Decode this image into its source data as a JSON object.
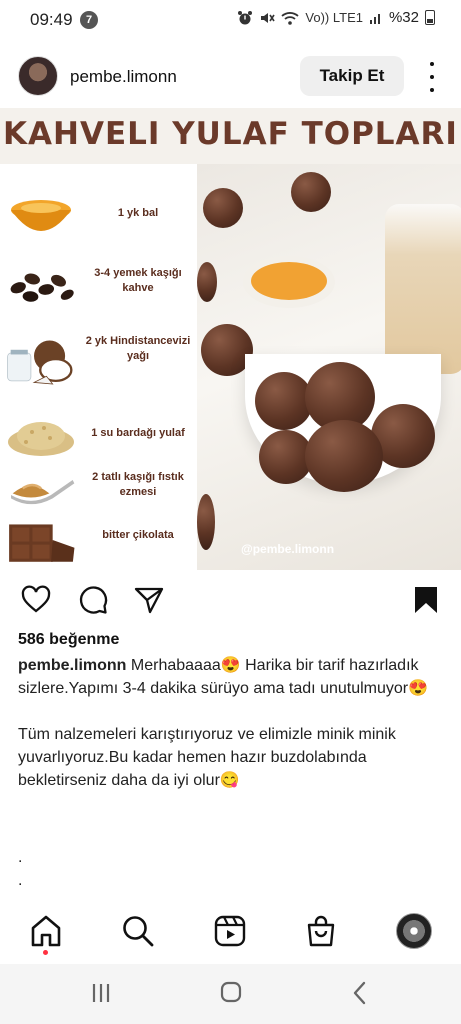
{
  "status_bar": {
    "time": "09:49",
    "notification_count": "7",
    "network": "Vo)) LTE1",
    "battery": "%32"
  },
  "post_header": {
    "username": "pembe.limonn",
    "follow_label": "Takip Et"
  },
  "post_image": {
    "title": "KAHVELI YULAF TOPLARI",
    "ingredients": [
      {
        "label": "1 yk bal",
        "icon": "honey-bowl-icon"
      },
      {
        "label": "3-4 yemek kaşığı kahve",
        "icon": "coffee-beans-icon"
      },
      {
        "label": "2 yk Hindistancevizi yağı",
        "icon": "coconut-icon"
      },
      {
        "label": "1 su bardağı yulaf",
        "icon": "oats-icon"
      },
      {
        "label": "2 tatlı kaşığı fıstık ezmesi",
        "icon": "peanut-butter-spoon-icon"
      },
      {
        "label": "bitter çikolata",
        "icon": "chocolate-bar-icon"
      }
    ],
    "watermark": "@pembe.limonn"
  },
  "actions": {
    "like_icon": "heart-icon",
    "comment_icon": "comment-icon",
    "share_icon": "send-icon",
    "save_icon": "bookmark-icon"
  },
  "likes": "586 beğenme",
  "caption": {
    "username": "pembe.limonn",
    "text1": "Merhabaaaa😍 Harika bir tarif hazırladık sizlere.Yapımı 3-4 dakika sürüyo ama tadı unutulmuyor😍",
    "text2": "Tüm nalzemeleri karıştırıyoruz ve elimizle minik minik yuvarlıyoruz.Bu kadar hemen hazır buzdolabında bekletirseniz daha da iyi olur😋",
    "dot1": ".",
    "dot2": "."
  },
  "colors": {
    "title": "#6b3a2a",
    "ingredient_text": "#5a2d1e",
    "follow_bg": "#efefef",
    "notification_dot": "#ff3040"
  }
}
